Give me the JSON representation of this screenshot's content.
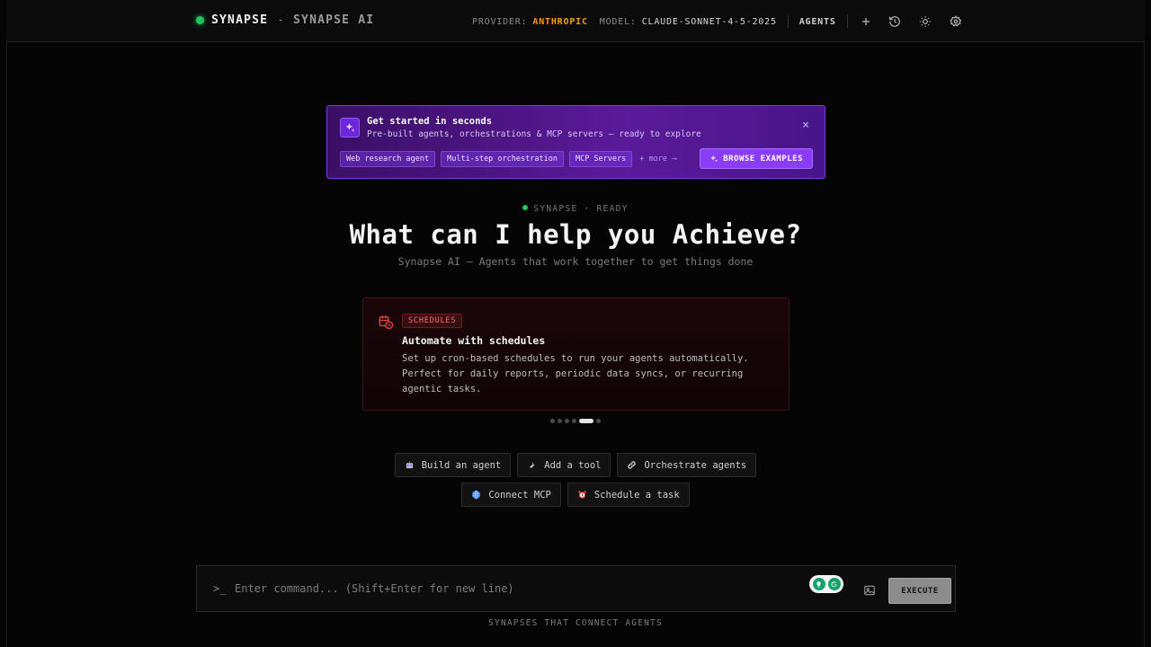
{
  "header": {
    "brand": "SYNAPSE",
    "separator": "-",
    "brand_sub": "SYNAPSE AI",
    "provider_label": "PROVIDER:",
    "provider_value": "ANTHROPIC",
    "model_label": "MODEL:",
    "model_value": "CLAUDE-SONNET-4-5-2025…",
    "agents_label": "AGENTS",
    "icons": [
      "plus-icon",
      "history-icon",
      "sun-icon",
      "gear-icon"
    ]
  },
  "promo": {
    "title": "Get started in seconds",
    "subtitle": "Pre-built agents, orchestrations & MCP servers — ready to explore",
    "chips": [
      "Web research agent",
      "Multi-step orchestration",
      "MCP Servers"
    ],
    "more": "+ more ⟶",
    "cta": "BROWSE EXAMPLES",
    "close": "×"
  },
  "hero": {
    "status": "SYNAPSE · READY",
    "title": "What can I help you Achieve?",
    "subtitle": "Synapse AI — Agents that work together to get things done"
  },
  "tip": {
    "badge": "SCHEDULES",
    "title": "Automate with schedules",
    "body": "Set up cron-based schedules to run your agents automatically. Perfect for daily reports, periodic data syncs, or recurring agentic tasks.",
    "carousel_total": 6,
    "carousel_active": 5
  },
  "quick_actions": {
    "row1": [
      "Build an agent",
      "Add a tool",
      "Orchestrate agents"
    ],
    "row2": [
      "Connect MCP",
      "Schedule a task"
    ]
  },
  "command": {
    "prompt": ">_",
    "placeholder": "Enter command... (Shift+Enter for new line)",
    "execute": "EXECUTE"
  },
  "footer": {
    "tagline": "SYNAPSES THAT CONNECT AGENTS"
  },
  "colors": {
    "accent_purple": "#8b3cf5",
    "provider_orange": "#f59e0b",
    "status_green": "#22c55e",
    "tip_red": "#ef4444"
  }
}
